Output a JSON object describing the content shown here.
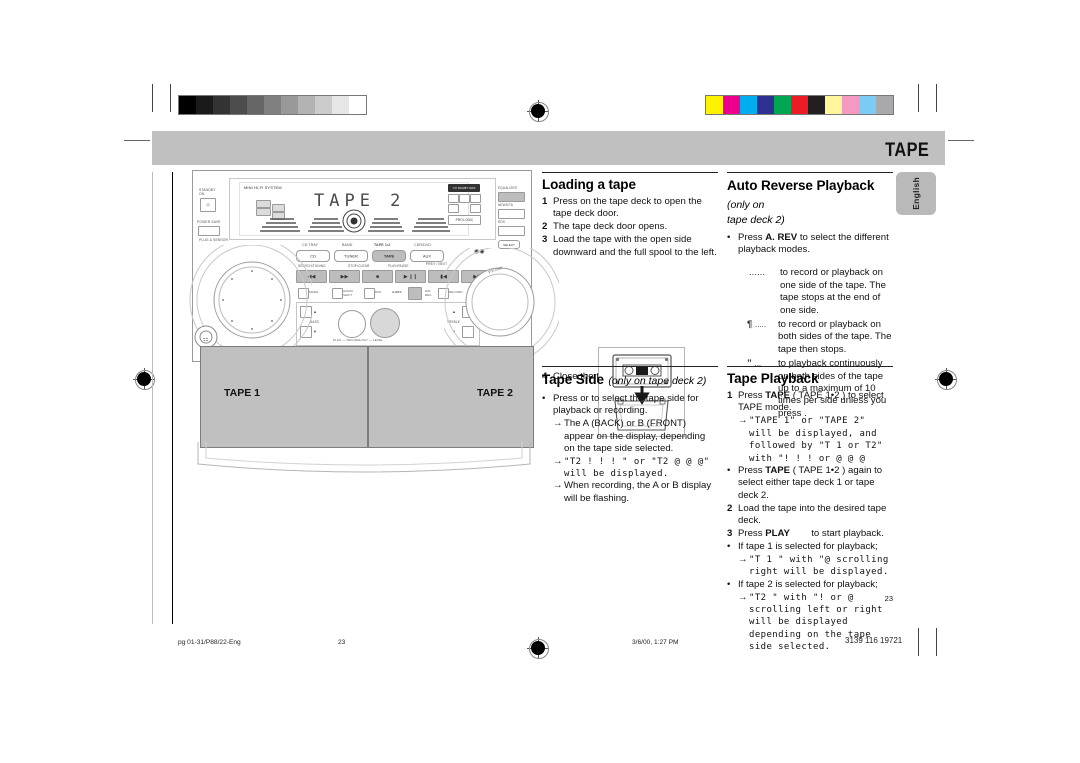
{
  "header": {
    "title": "TAPE"
  },
  "side_tab": {
    "label": "English"
  },
  "page_number": "23",
  "sections": {
    "loading": {
      "heading": "Loading a tape",
      "steps": [
        {
          "num": "1",
          "text": "Press on the tape deck to open the tape deck door."
        },
        {
          "num": "2",
          "text": "The tape deck door opens."
        },
        {
          "num": "3",
          "text": "Load the tape with the open side downward and the full spool to the left."
        }
      ],
      "step4": {
        "num": "4",
        "text": "Close the tape deck door."
      }
    },
    "tape_side": {
      "heading": "Tape Side",
      "heading_note": "(only on tape deck 2)",
      "bullet": "Press        or        to select the tape side for playback or recording.",
      "arrows": [
        "The A  (BACK) or B  (FRONT) appear on the display, depending on the tape side selected.",
        "\"T2  ! ! !  \" or \"T2  @ @ @\" will be displayed.",
        "When recording, the A  or B  display will be flashing."
      ]
    },
    "auto_reverse": {
      "heading": "Auto Reverse Playback",
      "heading_note": "(only on",
      "subheading": "tape deck 2)",
      "bullet": "Press A. REV to select the different playback modes.",
      "bullet_bold": "A. REV",
      "modes": [
        {
          "symbol": "......",
          "text": "to record or playback on one side of the tape. The tape stops at the end of one side."
        },
        {
          "symbol": "¶",
          "text": "to record or playback on both sides of the tape. The tape then stops.",
          "dots": "....."
        },
        {
          "symbol": "”",
          "text": "to playback continuously on both sides of the tape up to a maximum of 10 times per side unless you press       .",
          "dots": "..."
        }
      ]
    },
    "tape_playback": {
      "heading": "Tape Playback",
      "items": [
        {
          "num": "1",
          "text": "Press TAPE ( TAPE 1•2 ) to select TAPE mode.",
          "bold": "TAPE"
        },
        {
          "num": "→",
          "text": "\"TAPE  1\" or \"TAPE  2\" will be displayed,  and followed by \"T 1  or  T2\" with \"! ! !    or  @ @ @",
          "indent": true
        },
        {
          "num": "•",
          "text": "Press TAPE ( TAPE 1•2 ) again to select either tape deck 1 or tape deck 2.",
          "bold": "TAPE"
        },
        {
          "num": "2",
          "text": "Load the tape into the desired tape deck."
        },
        {
          "num": "3",
          "text": "Press PLAY           to start playback.",
          "bold": "PLAY"
        },
        {
          "num": "•",
          "text": "If tape 1 is selected for playback;"
        },
        {
          "num": "→",
          "text": "\"T 1 \" with \"@ scrolling right will be displayed.",
          "indent": true
        },
        {
          "num": "•",
          "text": "If tape 2 is selected for playback;"
        },
        {
          "num": "→",
          "text": "\"T2 \" with \"!  or  @ scrolling left or right will be displayed depending on the tape side selected.",
          "indent": true
        }
      ]
    }
  },
  "device": {
    "brand_label": "MINI HI-FI SYSTEM",
    "display_text": "TAPE 2",
    "source_labels": [
      "CD TRAY",
      "BAND",
      "TAPE 1•2",
      "CDR/DVD"
    ],
    "source_buttons": [
      "CD",
      "TUNER",
      "TAPE",
      "AUX"
    ],
    "selected_source": "TAPE",
    "transport_labels": [
      "SEARCH / TUNING",
      "STOP•CLEAR",
      "PLAY•PAUSE",
      "PREV  •  NEXT"
    ],
    "volume_label": "VOLUME",
    "bass_label": "BASS",
    "treble_label": "TREBLE",
    "level_label": "PLUS — TECHNOLOGY — LEVEL",
    "prologic_label": "PRO LOGIC",
    "dolby_label": "DOLBY SURROUND",
    "standby_label": "STANDBY ON",
    "cd_label": "CD",
    "deck_labels": [
      "TAPE 1",
      "TAPE 2"
    ],
    "right_buttons": [
      "EQUALIZER",
      "NEWS/TA",
      "RDS",
      "SELECT"
    ],
    "mode_labels": [
      "MODE",
      "AUDIO SHIFT",
      "DIM",
      "A. REV",
      "DIR RECORD",
      "RECORD"
    ]
  },
  "footer": {
    "left": "pg 01-31/P88/22-Eng",
    "page": "23",
    "date": "3/6/00, 1:27 PM",
    "code": "3139 116 19721"
  },
  "calibration": {
    "gray_steps": [
      "#000000",
      "#1a1a1a",
      "#333333",
      "#4d4d4d",
      "#666666",
      "#808080",
      "#999999",
      "#b3b3b3",
      "#cccccc",
      "#e6e6e6",
      "#ffffff"
    ],
    "color_steps": [
      "#fff200",
      "#ec008c",
      "#00aeef",
      "#2e3192",
      "#00a651",
      "#ed1c24",
      "#231f20",
      "#fff79a",
      "#f49ac1",
      "#7accf5",
      "#a7a9ac"
    ]
  },
  "colors": {
    "header_band": "#c0c0c0",
    "deck_bay": "#c0c0c0",
    "side_tab": "#b9b9b9",
    "accent_text": "#000000"
  }
}
